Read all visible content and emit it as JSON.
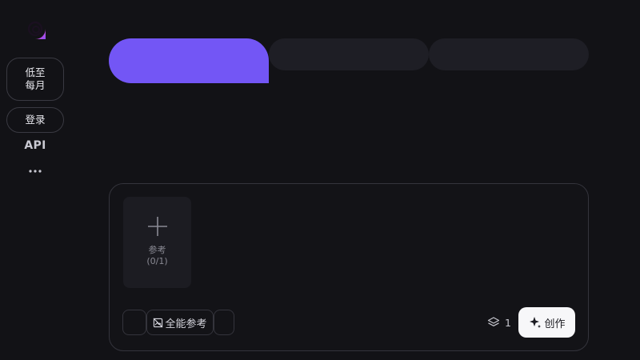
{
  "sidebar": {
    "logo_icon": "spiral-logo-icon",
    "promo": {
      "line1": "低至",
      "line2": "每月"
    },
    "login_label": "登录",
    "api_label": "API",
    "more_icon": "more-horizontal-icon"
  },
  "tabs": [
    {
      "label": "",
      "active": true
    },
    {
      "label": "",
      "active": false
    },
    {
      "label": "",
      "active": false
    }
  ],
  "composer": {
    "reference_upload": {
      "label": "参考",
      "count": "(0/1)"
    },
    "toolbar": {
      "reference_mode_label": "全能参考"
    },
    "output_count": "1",
    "create_label": "创作"
  },
  "colors": {
    "background": "#121216",
    "accent": "#7356f5",
    "tab_inactive": "#1e1e25",
    "create_button": "#f7f7f9"
  }
}
